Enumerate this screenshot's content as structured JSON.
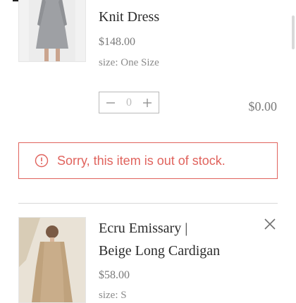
{
  "cart": {
    "items": [
      {
        "name": "Knit Dress",
        "price": "$148.00",
        "size": "size: One Size",
        "quantity": "0",
        "line_total": "$0.00",
        "alert": "Sorry, this item is out of stock."
      },
      {
        "name_line1": "Ecru Emissary |",
        "name_line2": "Beige Long Cardigan",
        "price": "$58.00",
        "size": "size: S"
      }
    ]
  },
  "colors": {
    "alert": "#e0635d",
    "text": "#2b2b2b",
    "muted": "#7a7a7a"
  },
  "icons": {
    "decrease": "minus-icon",
    "increase": "plus-icon",
    "alert": "alert-circle-icon",
    "remove": "close-icon"
  }
}
